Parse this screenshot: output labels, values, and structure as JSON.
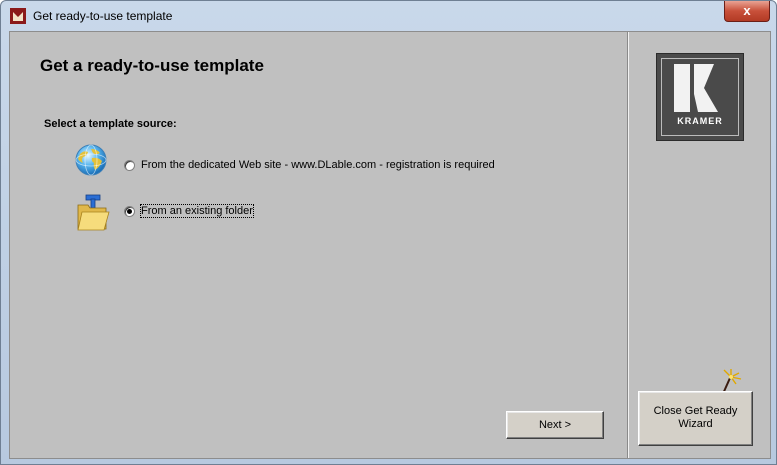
{
  "window": {
    "title": "Get ready-to-use template",
    "close_label": "x"
  },
  "main": {
    "heading": "Get a ready-to-use template",
    "subheading": "Select a template source:",
    "options": [
      {
        "label": "From the dedicated Web site - www.DLable.com - registration is required",
        "checked": false,
        "icon": "globe-icon"
      },
      {
        "label": "From an existing folder",
        "checked": true,
        "icon": "template-folder-icon"
      }
    ],
    "next_label": "Next >"
  },
  "side": {
    "logo_text": "KRAMER",
    "close_wizard_label_line1": "Close Get Ready",
    "close_wizard_label_line2": "Wizard",
    "wand_icon": "magic-wand-icon"
  },
  "colors": {
    "client_bg": "#c0c0c0",
    "title_gradient": "#c9d8ea",
    "close_red": "#c8503a"
  }
}
